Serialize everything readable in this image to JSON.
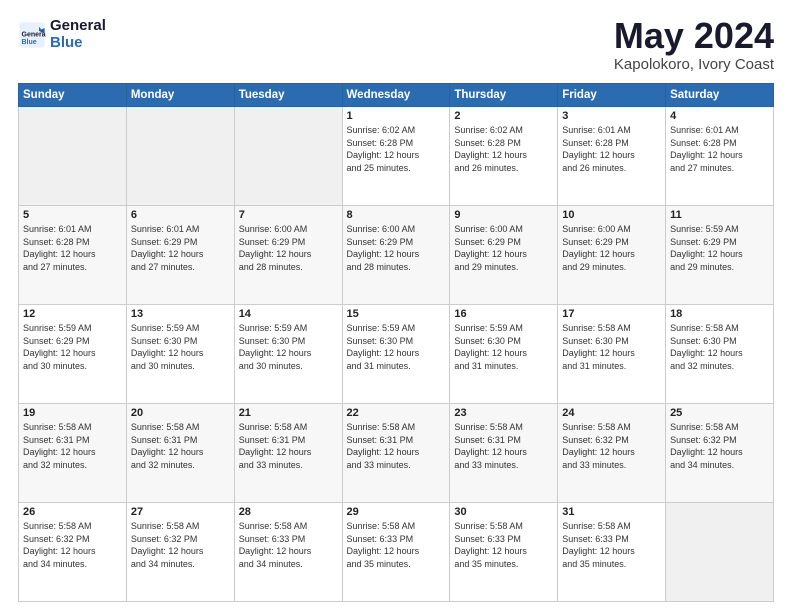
{
  "logo": {
    "line1": "General",
    "line2": "Blue"
  },
  "title": "May 2024",
  "location": "Kapolokoro, Ivory Coast",
  "days_of_week": [
    "Sunday",
    "Monday",
    "Tuesday",
    "Wednesday",
    "Thursday",
    "Friday",
    "Saturday"
  ],
  "weeks": [
    [
      {
        "day": "",
        "info": ""
      },
      {
        "day": "",
        "info": ""
      },
      {
        "day": "",
        "info": ""
      },
      {
        "day": "1",
        "info": "Sunrise: 6:02 AM\nSunset: 6:28 PM\nDaylight: 12 hours\nand 25 minutes."
      },
      {
        "day": "2",
        "info": "Sunrise: 6:02 AM\nSunset: 6:28 PM\nDaylight: 12 hours\nand 26 minutes."
      },
      {
        "day": "3",
        "info": "Sunrise: 6:01 AM\nSunset: 6:28 PM\nDaylight: 12 hours\nand 26 minutes."
      },
      {
        "day": "4",
        "info": "Sunrise: 6:01 AM\nSunset: 6:28 PM\nDaylight: 12 hours\nand 27 minutes."
      }
    ],
    [
      {
        "day": "5",
        "info": "Sunrise: 6:01 AM\nSunset: 6:28 PM\nDaylight: 12 hours\nand 27 minutes."
      },
      {
        "day": "6",
        "info": "Sunrise: 6:01 AM\nSunset: 6:29 PM\nDaylight: 12 hours\nand 27 minutes."
      },
      {
        "day": "7",
        "info": "Sunrise: 6:00 AM\nSunset: 6:29 PM\nDaylight: 12 hours\nand 28 minutes."
      },
      {
        "day": "8",
        "info": "Sunrise: 6:00 AM\nSunset: 6:29 PM\nDaylight: 12 hours\nand 28 minutes."
      },
      {
        "day": "9",
        "info": "Sunrise: 6:00 AM\nSunset: 6:29 PM\nDaylight: 12 hours\nand 29 minutes."
      },
      {
        "day": "10",
        "info": "Sunrise: 6:00 AM\nSunset: 6:29 PM\nDaylight: 12 hours\nand 29 minutes."
      },
      {
        "day": "11",
        "info": "Sunrise: 5:59 AM\nSunset: 6:29 PM\nDaylight: 12 hours\nand 29 minutes."
      }
    ],
    [
      {
        "day": "12",
        "info": "Sunrise: 5:59 AM\nSunset: 6:29 PM\nDaylight: 12 hours\nand 30 minutes."
      },
      {
        "day": "13",
        "info": "Sunrise: 5:59 AM\nSunset: 6:30 PM\nDaylight: 12 hours\nand 30 minutes."
      },
      {
        "day": "14",
        "info": "Sunrise: 5:59 AM\nSunset: 6:30 PM\nDaylight: 12 hours\nand 30 minutes."
      },
      {
        "day": "15",
        "info": "Sunrise: 5:59 AM\nSunset: 6:30 PM\nDaylight: 12 hours\nand 31 minutes."
      },
      {
        "day": "16",
        "info": "Sunrise: 5:59 AM\nSunset: 6:30 PM\nDaylight: 12 hours\nand 31 minutes."
      },
      {
        "day": "17",
        "info": "Sunrise: 5:58 AM\nSunset: 6:30 PM\nDaylight: 12 hours\nand 31 minutes."
      },
      {
        "day": "18",
        "info": "Sunrise: 5:58 AM\nSunset: 6:30 PM\nDaylight: 12 hours\nand 32 minutes."
      }
    ],
    [
      {
        "day": "19",
        "info": "Sunrise: 5:58 AM\nSunset: 6:31 PM\nDaylight: 12 hours\nand 32 minutes."
      },
      {
        "day": "20",
        "info": "Sunrise: 5:58 AM\nSunset: 6:31 PM\nDaylight: 12 hours\nand 32 minutes."
      },
      {
        "day": "21",
        "info": "Sunrise: 5:58 AM\nSunset: 6:31 PM\nDaylight: 12 hours\nand 33 minutes."
      },
      {
        "day": "22",
        "info": "Sunrise: 5:58 AM\nSunset: 6:31 PM\nDaylight: 12 hours\nand 33 minutes."
      },
      {
        "day": "23",
        "info": "Sunrise: 5:58 AM\nSunset: 6:31 PM\nDaylight: 12 hours\nand 33 minutes."
      },
      {
        "day": "24",
        "info": "Sunrise: 5:58 AM\nSunset: 6:32 PM\nDaylight: 12 hours\nand 33 minutes."
      },
      {
        "day": "25",
        "info": "Sunrise: 5:58 AM\nSunset: 6:32 PM\nDaylight: 12 hours\nand 34 minutes."
      }
    ],
    [
      {
        "day": "26",
        "info": "Sunrise: 5:58 AM\nSunset: 6:32 PM\nDaylight: 12 hours\nand 34 minutes."
      },
      {
        "day": "27",
        "info": "Sunrise: 5:58 AM\nSunset: 6:32 PM\nDaylight: 12 hours\nand 34 minutes."
      },
      {
        "day": "28",
        "info": "Sunrise: 5:58 AM\nSunset: 6:33 PM\nDaylight: 12 hours\nand 34 minutes."
      },
      {
        "day": "29",
        "info": "Sunrise: 5:58 AM\nSunset: 6:33 PM\nDaylight: 12 hours\nand 35 minutes."
      },
      {
        "day": "30",
        "info": "Sunrise: 5:58 AM\nSunset: 6:33 PM\nDaylight: 12 hours\nand 35 minutes."
      },
      {
        "day": "31",
        "info": "Sunrise: 5:58 AM\nSunset: 6:33 PM\nDaylight: 12 hours\nand 35 minutes."
      },
      {
        "day": "",
        "info": ""
      }
    ]
  ]
}
